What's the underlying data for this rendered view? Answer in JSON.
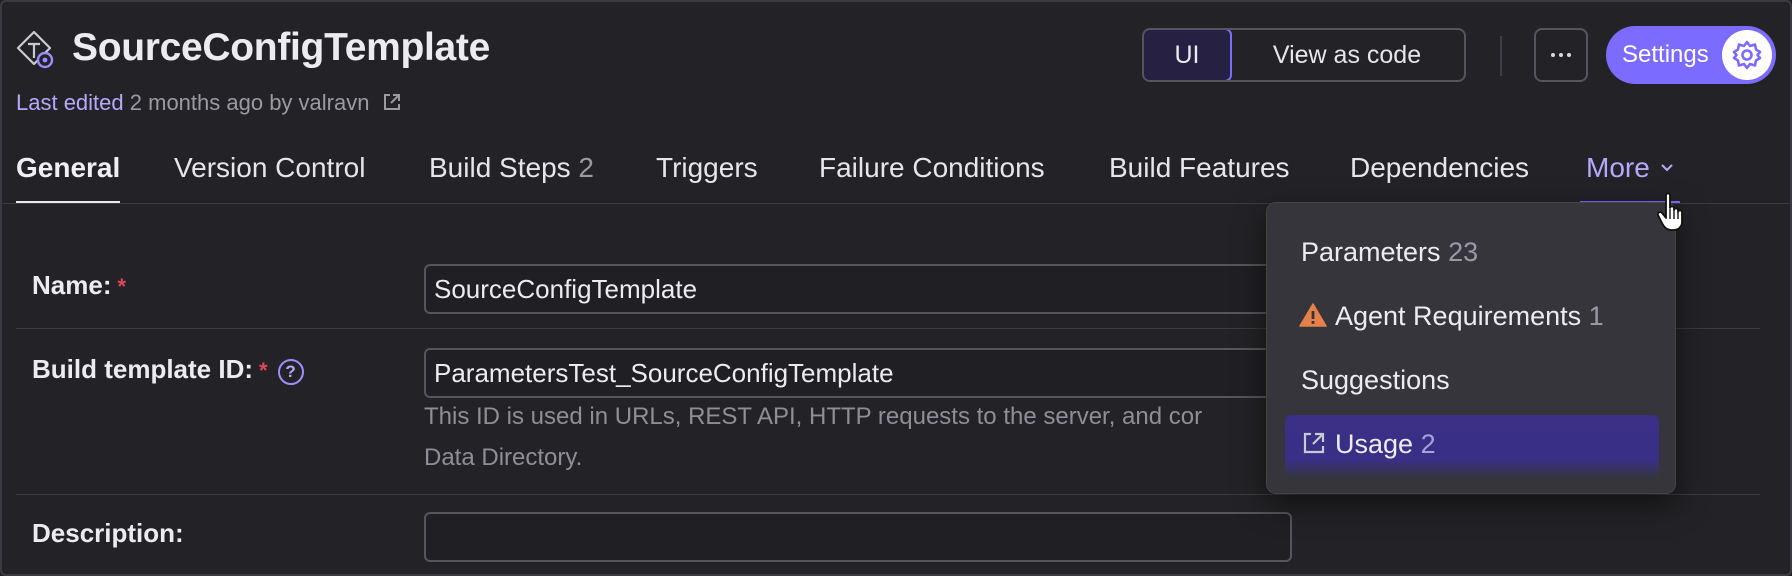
{
  "header": {
    "title": "SourceConfigTemplate",
    "icon": "template-settings-icon",
    "last_edited_label": "Last edited",
    "last_edited_info": "2 months ago by valravn"
  },
  "view_toggle": {
    "ui_label": "UI",
    "code_label": "View as code"
  },
  "actions": {
    "more_icon": "ellipsis-icon",
    "settings_label": "Settings",
    "settings_icon": "gear-icon"
  },
  "tabs": [
    {
      "label": "General",
      "count": ""
    },
    {
      "label": "Version Control",
      "count": ""
    },
    {
      "label": "Build Steps",
      "count": "2"
    },
    {
      "label": "Triggers",
      "count": ""
    },
    {
      "label": "Failure Conditions",
      "count": ""
    },
    {
      "label": "Build Features",
      "count": ""
    },
    {
      "label": "Dependencies",
      "count": ""
    },
    {
      "label": "More",
      "count": ""
    }
  ],
  "form": {
    "name_label": "Name:",
    "name_value": "SourceConfigTemplate",
    "id_label": "Build template ID:",
    "id_value": "ParametersTest_SourceConfigTemplate",
    "id_note_line1": "This ID is used in URLs, REST API, HTTP requests to the server, and cor",
    "id_note_line2": "Data Directory.",
    "description_label": "Description:",
    "description_value": "",
    "required_mark": "*",
    "help_mark": "?"
  },
  "more_menu": {
    "items": [
      {
        "label": "Parameters",
        "count": "23"
      },
      {
        "label": "Agent Requirements",
        "count": "1",
        "icon": "warning-icon"
      },
      {
        "label": "Suggestions",
        "count": ""
      },
      {
        "label": "Usage",
        "count": "2",
        "icon": "external-link-icon"
      }
    ]
  },
  "colors": {
    "accent": "#7b6cff",
    "background": "#232327",
    "warning": "#e8804a"
  }
}
